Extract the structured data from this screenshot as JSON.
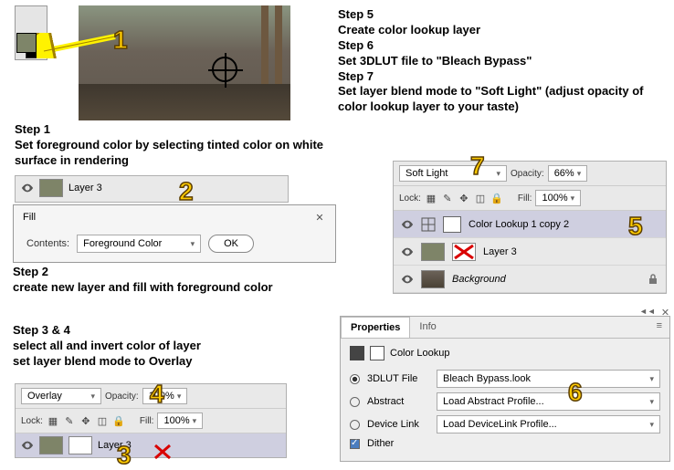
{
  "steps": {
    "s1_title": "Step 1",
    "s1_body": "Set foreground color by selecting tinted color on white surface in rendering",
    "s2_title": "Step 2",
    "s2_body": "create new layer and fill with foreground color",
    "s34_title": "Step 3 & 4",
    "s34_line1": "select all and invert color of layer",
    "s34_line2": "set layer blend mode to Overlay",
    "s5_title": "Step 5",
    "s5_body": "Create color lookup layer",
    "s6_title": "Step 6",
    "s6_body": "Set 3DLUT file to \"Bleach Bypass\"",
    "s7_title": "Step 7",
    "s7_body": "Set layer blend mode to \"Soft Light\" (adjust opacity of color lookup layer to your taste)"
  },
  "layers_top": {
    "layer_name": "Layer 3"
  },
  "fill_dialog": {
    "title": "Fill",
    "contents_label": "Contents:",
    "contents_value": "Foreground Color",
    "ok": "OK"
  },
  "panel_bottom": {
    "blend_mode": "Overlay",
    "opacity_label": "Opacity:",
    "opacity_value": "100%",
    "lock_label": "Lock:",
    "fill_label": "Fill:",
    "fill_value": "100%",
    "layer_name": "Layer 3"
  },
  "panel_right": {
    "blend_mode": "Soft Light",
    "opacity_label": "Opacity:",
    "opacity_value": "66%",
    "lock_label": "Lock:",
    "fill_label": "Fill:",
    "fill_value": "100%",
    "layer1": "Color Lookup 1 copy 2",
    "layer2": "Layer 3",
    "layer3": "Background"
  },
  "properties": {
    "tab1": "Properties",
    "tab2": "Info",
    "title": "Color Lookup",
    "row1_label": "3DLUT File",
    "row1_value": "Bleach Bypass.look",
    "row2_label": "Abstract",
    "row2_value": "Load Abstract Profile...",
    "row3_label": "Device Link",
    "row3_value": "Load DeviceLink Profile...",
    "row4_label": "Dither"
  },
  "badges": {
    "n1": "1",
    "n2": "2",
    "n3": "3",
    "n4": "4",
    "n5": "5",
    "n6": "6",
    "n7": "7"
  }
}
